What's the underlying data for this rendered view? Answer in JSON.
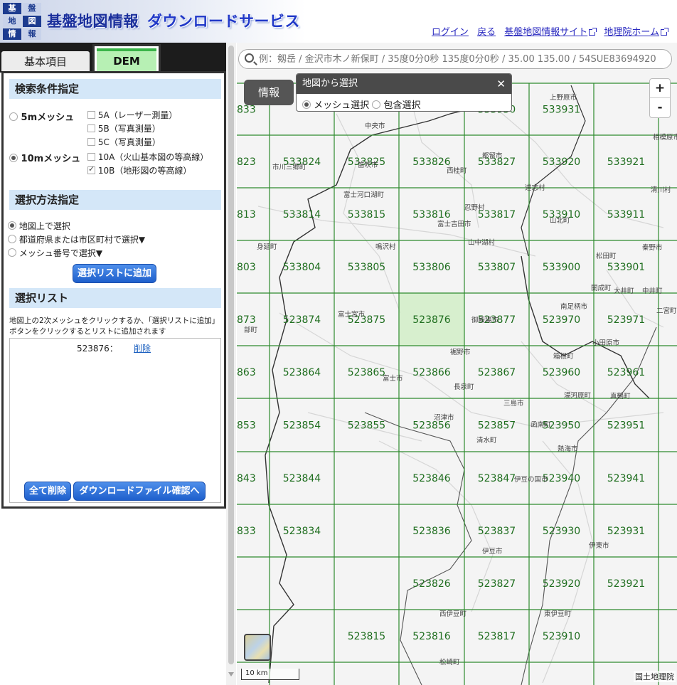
{
  "header": {
    "logo_chars": [
      "基",
      "盤",
      "地",
      "図",
      "情",
      "報"
    ],
    "title_main": "基盤地図情報",
    "title_sub": "ダウンロードサービス",
    "links": [
      "ログイン",
      "戻る",
      "基盤地図情報サイト",
      "地理院ホーム"
    ]
  },
  "tabs": {
    "basic": "基本項目",
    "dem": "DEM"
  },
  "search_conditions": {
    "heading": "検索条件指定",
    "mesh5": {
      "label": "5mメッシュ",
      "selected": false
    },
    "mesh10": {
      "label": "10mメッシュ",
      "selected": true
    },
    "options": [
      {
        "label": "5A（レーザー測量）",
        "checked": false
      },
      {
        "label": "5B（写真測量）",
        "checked": false
      },
      {
        "label": "5C（写真測量）",
        "checked": false
      },
      {
        "label": "10A（火山基本図の等高線）",
        "checked": false
      },
      {
        "label": "10B（地形図の等高線）",
        "checked": true
      }
    ]
  },
  "select_method": {
    "heading": "選択方法指定",
    "options": [
      {
        "label": "地図上で選択",
        "selected": true
      },
      {
        "label": "都道府県または市区町村で選択▼",
        "selected": false
      },
      {
        "label": "メッシュ番号で選択▼",
        "selected": false
      }
    ],
    "add_button": "選択リストに追加"
  },
  "selection_list": {
    "heading": "選択リスト",
    "hint": "地図上の2次メッシュをクリックするか、「選択リストに追加」ボタンをクリックするとリストに追加されます",
    "items": [
      {
        "code": "523876：",
        "delete_label": "削除"
      }
    ],
    "delete_all": "全て削除",
    "confirm": "ダウンロードファイル確認へ"
  },
  "map": {
    "search_placeholder": "例：剱岳 / 金沢市木ノ新保町 / 35度0分0秒 135度0分0秒 / 35.00 135.00 / 54SUE83694920",
    "info_button": "情報",
    "select_popup": {
      "title": "地図から選択",
      "close": "✕",
      "option_mesh": "メッシュ選択",
      "option_include": "包含選択",
      "mesh_selected": true
    },
    "zoom_in": "+",
    "zoom_out": "-",
    "scale": "10 km",
    "attribution": "国土地理院",
    "selected_mesh": "523876",
    "mesh_color": "#2e8b2e",
    "selected_fill": "#cdeec2",
    "mesh_rows": [
      [
        "833",
        "",
        "",
        "",
        "533930",
        "533931"
      ],
      [
        "823",
        "533824",
        "533825",
        "533826",
        "533827",
        "533920",
        "533921"
      ],
      [
        "813",
        "533814",
        "533815",
        "533816",
        "533817",
        "533910",
        "533911"
      ],
      [
        "803",
        "533804",
        "533805",
        "533806",
        "533807",
        "533900",
        "533901"
      ],
      [
        "873",
        "523874",
        "523875",
        "523876",
        "523877",
        "523970",
        "523971"
      ],
      [
        "863",
        "523864",
        "523865",
        "523866",
        "523867",
        "523960",
        "523961"
      ],
      [
        "853",
        "523854",
        "523855",
        "523856",
        "523857",
        "523950",
        "523951"
      ],
      [
        "843",
        "523844",
        "",
        "523846",
        "523847",
        "523940",
        "523941"
      ],
      [
        "833",
        "523834",
        "",
        "523836",
        "523837",
        "523930",
        "523931"
      ],
      [
        "",
        "",
        "",
        "523826",
        "523827",
        "523920",
        "523921"
      ],
      [
        "",
        "",
        "523815",
        "523816",
        "523817",
        "523910",
        ""
      ]
    ],
    "place_names": [
      "上野原市",
      "中央市",
      "笛吹市",
      "市川三郷町",
      "都留市",
      "西桂町",
      "道志村",
      "相模原市",
      "富士河口湖町",
      "忍野村",
      "山北町",
      "清川村",
      "富士吉田市",
      "鳴沢村",
      "身延町",
      "山中湖村",
      "松田町",
      "秦野市",
      "開成町",
      "大井町",
      "中井町",
      "南足柄市",
      "富士宮市",
      "御殿場市",
      "二宮町",
      "部町",
      "小田原市",
      "箱根町",
      "裾野市",
      "富士市",
      "湯河原町",
      "真鶴町",
      "長泉町",
      "三島市",
      "沼津市",
      "函南町",
      "清水町",
      "熱海市",
      "伊豆の国市",
      "伊東市",
      "伊豆市",
      "西伊豆町",
      "東伊豆町",
      "松崎町"
    ]
  }
}
